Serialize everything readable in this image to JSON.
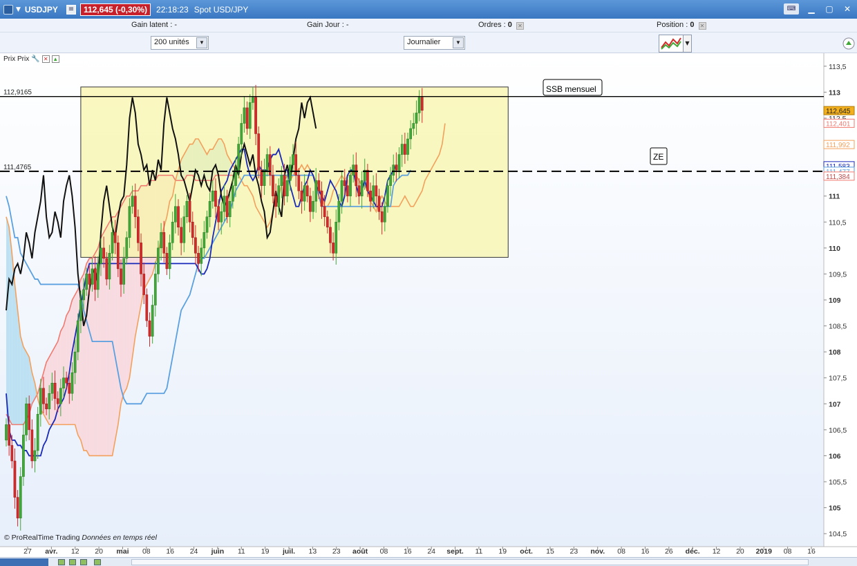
{
  "window": {
    "symbol": "USDJPY",
    "price_badge": "112,645 (-0,30%)",
    "time": "22:18:23",
    "instrument": "Spot USD/JPY"
  },
  "infobar": {
    "gain_latent_label": "Gain latent :",
    "gain_latent_value": "-",
    "gain_jour_label": "Gain Jour :",
    "gain_jour_value": "-",
    "ordres_label": "Ordres :",
    "ordres_value": "0",
    "position_label": "Position :",
    "position_value": "0"
  },
  "controls": {
    "quantity": "200 unités",
    "timeframe": "Journalier"
  },
  "chart_label": "Prix Prix",
  "copyright": "© ProRealTime Trading",
  "copyright_note": "Données en temps réel",
  "colors": {
    "up": "#3fa836",
    "down": "#d42a2a",
    "zone_fill": "#f8f5a8",
    "kumo_bull": "#bde1f2",
    "kumo_bear": "#f7dbe0",
    "tenkan": "#1828b8",
    "kijun": "#5aa0e0",
    "chikou": "#111111",
    "ssa": "#f3a05c",
    "ssb": "#f07a70"
  },
  "chart_data": {
    "type": "candlestick",
    "y_ticks": [
      "113,5",
      "113",
      "112,5",
      "112",
      "111,5",
      "111",
      "110,5",
      "110",
      "109,5",
      "109",
      "108,5",
      "108",
      "107,5",
      "107",
      "106,5",
      "106",
      "105,5",
      "105",
      "104,5"
    ],
    "ylim": [
      104.25,
      113.75
    ],
    "x_ticks": [
      {
        "label": "27",
        "bold": false
      },
      {
        "label": "avr.",
        "bold": true
      },
      {
        "label": "12",
        "bold": false
      },
      {
        "label": "20",
        "bold": false
      },
      {
        "label": "mai",
        "bold": true
      },
      {
        "label": "08",
        "bold": false
      },
      {
        "label": "16",
        "bold": false
      },
      {
        "label": "24",
        "bold": false
      },
      {
        "label": "juin",
        "bold": true
      },
      {
        "label": "11",
        "bold": false
      },
      {
        "label": "19",
        "bold": false
      },
      {
        "label": "juil.",
        "bold": true
      },
      {
        "label": "13",
        "bold": false
      },
      {
        "label": "23",
        "bold": false
      },
      {
        "label": "août",
        "bold": true
      },
      {
        "label": "08",
        "bold": false
      },
      {
        "label": "16",
        "bold": false
      },
      {
        "label": "24",
        "bold": false
      },
      {
        "label": "sept.",
        "bold": true
      },
      {
        "label": "11",
        "bold": false
      },
      {
        "label": "19",
        "bold": false
      },
      {
        "label": "oct.",
        "bold": true
      },
      {
        "label": "15",
        "bold": false
      },
      {
        "label": "23",
        "bold": false
      },
      {
        "label": "nov.",
        "bold": true
      },
      {
        "label": "08",
        "bold": false
      },
      {
        "label": "16",
        "bold": false
      },
      {
        "label": "26",
        "bold": false
      },
      {
        "label": "déc.",
        "bold": true
      },
      {
        "label": "12",
        "bold": false
      },
      {
        "label": "20",
        "bold": false
      },
      {
        "label": "2019",
        "bold": true
      },
      {
        "label": "08",
        "bold": false
      },
      {
        "label": "16",
        "bold": false
      }
    ],
    "horizontal_levels": [
      {
        "value": 112.9165,
        "label": "112,9165",
        "style": "solid"
      },
      {
        "value": 111.4765,
        "label": "111,4765",
        "style": "dashed"
      }
    ],
    "zone_box": {
      "from_bar": 26,
      "to_bar": 175,
      "y_low": 109.82,
      "y_high": 113.1
    },
    "annotations": [
      "SSB mensuel",
      "ZE"
    ],
    "price_labels": [
      {
        "value": 112.645,
        "text": "112,645",
        "kind": "last"
      },
      {
        "value": 112.401,
        "text": "112,401",
        "kind": "ssb"
      },
      {
        "value": 111.992,
        "text": "111,992",
        "kind": "ssa"
      },
      {
        "value": 111.583,
        "text": "111,583",
        "kind": "tenkan"
      },
      {
        "value": 111.477,
        "text": "111,477",
        "kind": "kijun"
      },
      {
        "value": 111.384,
        "text": "111,384",
        "kind": "ssb2"
      }
    ],
    "close": [
      106.6,
      106.2,
      105.9,
      105.2,
      104.8,
      105.6,
      106.4,
      107.0,
      106.5,
      105.9,
      106.1,
      106.8,
      107.3,
      107.0,
      106.9,
      107.2,
      107.4,
      107.1,
      107.0,
      107.3,
      107.5,
      107.4,
      107.2,
      107.6,
      108.0,
      108.6,
      109.0,
      109.2,
      109.5,
      109.3,
      109.6,
      109.2,
      109.7,
      110.0,
      109.8,
      109.4,
      109.9,
      110.3,
      110.1,
      109.6,
      109.3,
      109.8,
      110.2,
      110.8,
      111.0,
      110.6,
      110.1,
      109.5,
      109.1,
      108.6,
      108.3,
      108.9,
      109.5,
      110.0,
      110.3,
      109.9,
      109.6,
      110.1,
      110.5,
      110.8,
      110.4,
      110.1,
      110.6,
      110.9,
      110.5,
      110.2,
      109.9,
      109.7,
      110.0,
      110.3,
      110.6,
      110.9,
      111.1,
      110.8,
      110.5,
      110.7,
      111.0,
      110.6,
      110.9,
      111.2,
      111.5,
      112.0,
      112.4,
      112.7,
      112.3,
      112.8,
      112.9,
      112.2,
      111.5,
      111.2,
      111.5,
      111.8,
      111.4,
      111.0,
      110.8,
      111.2,
      111.4,
      111.0,
      111.3,
      111.6,
      111.8,
      111.4,
      111.1,
      110.9,
      111.2,
      111.0,
      110.7,
      110.9,
      111.3,
      111.1,
      110.8,
      110.6,
      110.4,
      110.1,
      109.9,
      110.5,
      110.9,
      111.3,
      111.2,
      111.0,
      111.4,
      111.6,
      111.2,
      111.0,
      111.3,
      111.5,
      111.1,
      110.9,
      111.2,
      111.0,
      110.7,
      110.5,
      110.8,
      111.2,
      111.4,
      111.6,
      111.5,
      111.8,
      112.0,
      111.8,
      112.1,
      112.3,
      112.4,
      112.6,
      112.9,
      112.65
    ],
    "chikou": [
      108.8,
      109.4,
      109.3,
      109.6,
      109.7,
      109.5,
      109.8,
      110.3,
      110.1,
      109.8,
      110.3,
      110.6,
      110.9,
      111.4,
      110.6,
      110.2,
      110.3,
      110.7,
      110.5,
      110.2,
      110.9,
      111.2,
      111.4,
      111.0,
      110.4,
      109.5,
      109.0,
      108.5,
      108.7,
      109.2,
      109.5,
      109.6,
      109.3,
      110.3,
      110.9,
      111.2,
      110.8,
      110.4,
      110.2,
      110.6,
      110.9,
      111.0,
      111.6,
      112.5,
      112.9,
      112.6,
      112.0,
      111.8,
      111.5,
      111.6,
      111.2,
      111.5,
      111.3,
      111.7,
      111.5,
      112.4,
      112.9,
      112.6,
      112.3,
      112.1,
      111.8,
      111.4,
      111.3,
      111.1,
      110.9,
      111.2,
      111.5,
      111.4,
      111.2,
      111.4,
      111.2,
      111.1,
      111.5,
      111.6,
      111.4,
      111.0,
      110.8,
      110.9,
      111.1,
      111.3,
      111.6,
      111.4,
      111.8,
      112.0,
      111.8,
      111.6,
      111.8,
      111.4,
      111.2,
      110.9,
      110.7,
      110.2,
      110.3,
      110.7,
      111.1,
      110.8,
      110.6,
      111.4,
      111.6,
      111.3,
      111.7,
      112.1,
      112.3,
      112.8,
      112.5,
      112.8,
      112.9,
      112.6,
      112.3
    ],
    "tenkan": [
      107.2,
      106.5,
      106.3,
      106.3,
      106.2,
      106.2,
      106.1,
      106.1,
      106.0,
      106.0,
      106.0,
      106.0,
      106.0,
      106.2,
      106.3,
      106.5,
      106.6,
      106.7,
      106.9,
      107.0,
      107.1,
      107.3,
      107.6,
      108.0,
      108.3,
      108.6,
      108.9,
      109.2,
      109.5,
      109.7,
      109.7,
      109.7,
      109.7,
      109.7,
      109.7,
      109.7,
      109.7,
      109.7,
      109.7,
      109.7,
      109.7,
      109.7,
      109.7,
      109.7,
      109.7,
      109.7,
      109.7,
      109.7,
      109.7,
      109.7,
      109.7,
      109.7,
      109.7,
      109.7,
      109.7,
      109.7,
      109.7,
      109.7,
      109.7,
      109.7,
      109.7,
      109.7,
      109.7,
      109.7,
      109.7,
      109.7,
      109.7,
      109.6,
      109.5,
      109.5,
      109.6,
      109.8,
      110.2,
      110.5,
      110.8,
      111.1,
      111.2,
      111.3,
      111.5,
      111.6,
      111.7,
      111.8,
      111.9,
      111.9,
      111.6,
      111.4,
      111.3,
      111.4,
      111.6,
      111.5,
      111.5,
      111.5,
      111.7,
      111.8,
      111.8,
      111.9,
      111.7,
      111.5,
      111.5,
      111.2,
      111.0,
      110.8,
      110.8,
      111.0,
      111.2,
      111.3,
      111.5,
      111.4,
      111.2,
      111.1,
      111.0,
      110.9,
      111.1,
      111.3,
      111.2,
      111.1,
      110.9,
      110.8,
      111.0,
      111.4,
      111.5,
      111.5,
      111.2,
      111.0,
      111.1,
      111.3,
      111.1,
      111.0,
      110.9,
      110.8,
      110.8,
      110.8,
      111.0,
      111.3,
      111.4,
      111.5,
      111.6
    ],
    "kijun": [
      111.0,
      110.8,
      110.5,
      110.2,
      110.2,
      109.9,
      109.8,
      109.7,
      109.6,
      109.5,
      109.4,
      109.4,
      109.3,
      109.3,
      109.3,
      109.3,
      109.3,
      109.3,
      109.3,
      109.3,
      109.3,
      109.3,
      109.3,
      109.3,
      109.3,
      109.3,
      109.1,
      108.8,
      108.6,
      108.4,
      108.2,
      108.2,
      108.2,
      108.2,
      108.2,
      108.2,
      108.2,
      108.2,
      107.9,
      107.6,
      107.3,
      107.1,
      107.0,
      107.0,
      107.0,
      107.0,
      107.0,
      107.0,
      107.1,
      107.2,
      107.2,
      107.2,
      107.2,
      107.2,
      107.2,
      107.2,
      107.3,
      107.6,
      107.9,
      108.2,
      108.5,
      108.8,
      108.9,
      109.0,
      109.1,
      109.3,
      109.5,
      109.7,
      109.8,
      109.8,
      109.9,
      110.0,
      110.1,
      110.2,
      110.3,
      110.4,
      110.5,
      110.6,
      110.7,
      110.9,
      111.1,
      111.2,
      111.3,
      111.4,
      111.4,
      111.4,
      111.4,
      111.4,
      111.4,
      111.4,
      111.4,
      111.4,
      111.4,
      111.4,
      111.4,
      111.4,
      111.4,
      111.4,
      111.4,
      111.4,
      111.4,
      111.4,
      111.4,
      111.4,
      111.4,
      111.4,
      111.4,
      111.4,
      111.2,
      111.0,
      110.8,
      110.8,
      110.8,
      110.8,
      110.8,
      110.8,
      110.8,
      110.8,
      110.8,
      110.8,
      110.8,
      110.8,
      110.8,
      110.8,
      110.8,
      110.8,
      110.8,
      110.8,
      110.8,
      110.8,
      110.8,
      110.8,
      110.8,
      110.8,
      110.8,
      111.2,
      111.3,
      111.35,
      111.4,
      111.4,
      111.4,
      111.5
    ],
    "ssa": [
      110.6,
      110.4,
      109.9,
      109.3,
      108.8,
      108.3,
      108.1,
      108.0,
      107.9,
      107.6,
      107.4,
      107.1,
      106.9,
      106.8,
      106.7,
      106.6,
      106.6,
      106.6,
      106.6,
      106.6,
      106.6,
      106.6,
      106.6,
      106.6,
      106.6,
      106.4,
      106.3,
      106.1,
      106.1,
      106.0,
      106.0,
      106.0,
      106.0,
      106.0,
      106.0,
      106.0,
      106.0,
      106.0,
      106.3,
      106.6,
      107.0,
      107.2,
      107.3,
      107.5,
      107.9,
      108.3,
      108.6,
      108.9,
      109.2,
      109.3,
      109.4,
      109.5,
      109.7,
      109.9,
      110.2,
      110.4,
      110.6,
      110.9,
      111.0,
      111.3,
      111.5,
      111.7,
      111.8,
      111.9,
      112.0,
      112.0,
      112.1,
      112.1,
      112.0,
      111.9,
      111.8,
      111.9,
      111.9,
      112.0,
      112.1,
      112.1,
      112.0,
      111.8,
      111.7,
      111.6,
      111.5,
      111.4,
      111.3,
      111.2,
      111.2,
      111.1,
      111.0,
      110.8,
      110.7,
      110.6,
      110.5,
      110.4,
      110.5,
      110.7,
      110.9,
      111.0,
      111.2,
      111.3,
      111.4,
      111.3,
      111.4,
      111.5,
      111.5,
      111.6,
      111.5,
      111.6,
      111.5,
      111.4,
      111.3,
      111.2,
      111.0,
      110.8,
      110.8,
      110.9,
      111.1,
      111.2,
      111.3,
      111.4,
      111.3,
      111.4,
      111.4,
      111.5,
      111.4,
      111.3,
      111.2,
      111.2,
      111.1,
      110.9,
      110.8,
      110.7,
      110.9,
      111.0,
      110.9,
      110.8,
      110.8,
      110.8,
      110.8,
      110.8,
      110.9,
      111.0,
      110.9,
      110.8,
      110.8,
      110.9,
      111.0,
      111.1,
      111.3,
      111.4,
      111.5,
      111.6,
      111.7,
      111.8,
      112.0,
      112.4
    ],
    "ssb": [
      106.8,
      106.7,
      106.6,
      106.6,
      106.6,
      106.6,
      106.6,
      106.7,
      106.8,
      107.0,
      107.1,
      107.2,
      107.4,
      107.6,
      107.8,
      107.9,
      108.0,
      108.1,
      108.2,
      108.4,
      108.5,
      108.7,
      108.8,
      109.0,
      109.1,
      109.2,
      109.4,
      109.5,
      109.7,
      109.8,
      109.8,
      109.9,
      110.0,
      110.2,
      110.3,
      110.4,
      110.5,
      110.6,
      110.6,
      110.7,
      110.8,
      110.9,
      111.0,
      111.0,
      111.1,
      111.1,
      111.1,
      111.2,
      111.2,
      111.2,
      111.3,
      111.3,
      111.3,
      111.4,
      111.4,
      111.4,
      111.4,
      111.4,
      111.4,
      111.3,
      111.3,
      111.3,
      111.3,
      111.4,
      111.4,
      111.4,
      111.3,
      111.3,
      111.3,
      111.3,
      111.3,
      111.3,
      111.3,
      111.4,
      111.4,
      111.4,
      111.4,
      111.4,
      111.4,
      111.4
    ]
  }
}
